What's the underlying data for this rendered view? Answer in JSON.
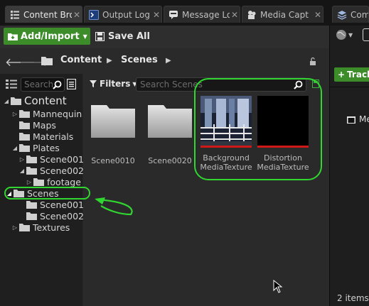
{
  "tabs": [
    {
      "label": "Content Bro",
      "icon": "content-browser-icon"
    },
    {
      "label": "Output Log",
      "icon": "output-log-icon"
    },
    {
      "label": "Message Lo",
      "icon": "message-log-icon"
    },
    {
      "label": "Media Capt",
      "icon": "media-capture-icon"
    },
    {
      "label": "Com",
      "icon": "layers-icon"
    }
  ],
  "toolbar": {
    "add_import": "Add/Import",
    "save_all": "Save All"
  },
  "path": {
    "root": "Content",
    "current": "Scenes"
  },
  "sources": {
    "search_placeholder": "Search",
    "tree": [
      {
        "label": "Content",
        "expanded": true
      },
      {
        "label": "Mannequin"
      },
      {
        "label": "Maps"
      },
      {
        "label": "Materials"
      },
      {
        "label": "Plates",
        "expanded": true
      },
      {
        "label": "Scene001"
      },
      {
        "label": "Scene002",
        "expanded": true
      },
      {
        "label": "footage"
      },
      {
        "label": "Scenes",
        "expanded": true,
        "selected": true
      },
      {
        "label": "Scene001"
      },
      {
        "label": "Scene002"
      },
      {
        "label": "Textures"
      }
    ]
  },
  "filters": {
    "label": "Filters",
    "search_placeholder": "Search Scenes"
  },
  "assets": [
    {
      "type": "folder",
      "label": "Scene0010"
    },
    {
      "type": "folder",
      "label": "Scene0020"
    },
    {
      "type": "media-texture",
      "label_line1": "Background",
      "label_line2": "MediaTexture"
    },
    {
      "type": "media-texture",
      "label_line1": "Distortion",
      "label_line2": "MediaTexture"
    }
  ],
  "sequencer": {
    "track_button": "Track",
    "item_label": "Me",
    "item_count": "2 items"
  },
  "colors": {
    "highlight_green": "#31d631",
    "accent_green": "#3c8c2a",
    "progress_red": "#d01818"
  }
}
